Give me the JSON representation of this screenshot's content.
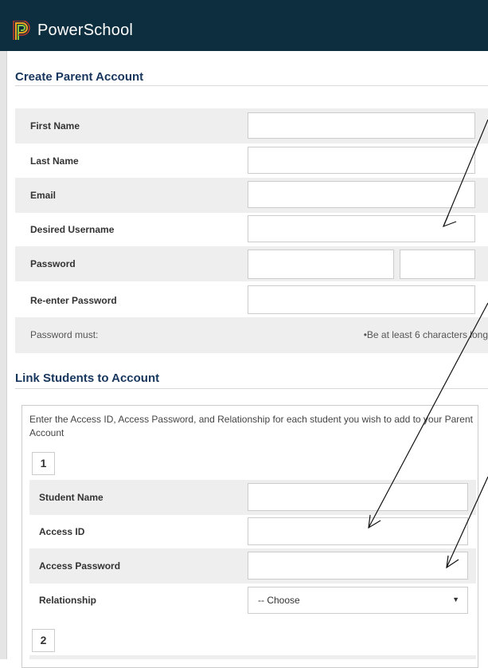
{
  "app": {
    "name": "PowerSchool"
  },
  "create_account": {
    "title": "Create Parent Account",
    "fields": [
      {
        "label": "First Name",
        "value": ""
      },
      {
        "label": "Last Name",
        "value": ""
      },
      {
        "label": "Email",
        "value": ""
      },
      {
        "label": "Desired Username",
        "value": ""
      },
      {
        "label": "Password",
        "value": ""
      },
      {
        "label": "Re-enter Password",
        "value": ""
      }
    ],
    "password_note": "Password must:",
    "password_rule": "•Be at least 6 characters long"
  },
  "link_students": {
    "title": "Link Students to Account",
    "instructions": "Enter the Access ID, Access Password, and Relationship for each student you wish to add to your Parent Account",
    "student_1": {
      "number": "1",
      "fields": [
        {
          "label": "Student Name",
          "value": ""
        },
        {
          "label": "Access ID",
          "value": ""
        },
        {
          "label": "Access Password",
          "value": ""
        }
      ],
      "relationship_label": "Relationship",
      "relationship_value": "-- Choose"
    },
    "student_2": {
      "number": "2"
    }
  },
  "colors": {
    "header_bg": "#0c2e3f",
    "title_text": "#17365d",
    "row_shade": "#eeeeee"
  },
  "icons": [
    "powerschool-logo-icon",
    "chevron-down-icon",
    "annotation-arrow"
  ]
}
